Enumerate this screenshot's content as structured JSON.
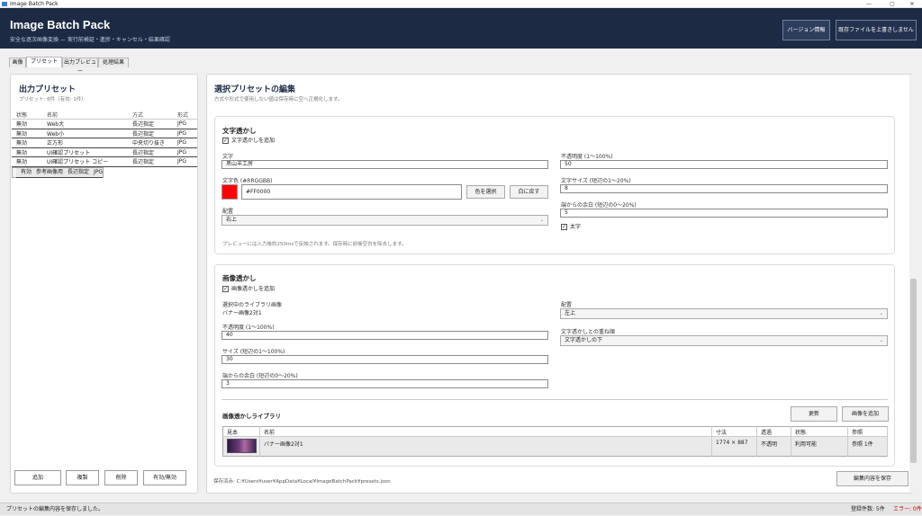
{
  "window": {
    "title": "Image Batch Pack",
    "minimize": "—",
    "maximize": "▢"
  },
  "header": {
    "title": "Image Batch Pack",
    "subtitle": "安全な逐次画像変換 — 実行前検証・進捗・キャンセル・結果確認",
    "version_button": "バージョン情報",
    "overwrite_button": "既存ファイルを上書きしません"
  },
  "tabs": [
    "画像",
    "プリセット",
    "出力プレビュー",
    "処理結果"
  ],
  "active_tab": "プリセット",
  "left": {
    "title": "出力プリセット",
    "subtitle": "プリセット: 6件（有効: 1件）",
    "columns": [
      "状態",
      "名前",
      "方式",
      "形式"
    ],
    "rows": [
      [
        "無効",
        "Web大",
        "長辺指定",
        "JPG"
      ],
      [
        "無効",
        "Web小",
        "長辺指定",
        "JPG"
      ],
      [
        "無効",
        "正方形",
        "中央切り抜き",
        "JPG"
      ],
      [
        "無効",
        "UI確認プリセット",
        "長辺指定",
        "JPG"
      ],
      [
        "無効",
        "UI確認プリセット コピー",
        "長辺指定",
        "JPG"
      ],
      [
        "有効",
        "参考画像用",
        "長辺指定",
        "JPG"
      ]
    ],
    "buttons": {
      "add": "追加",
      "duplicate": "複製",
      "delete": "削除",
      "toggle": "有効/無効"
    }
  },
  "right": {
    "title": "選択プリセットの編集",
    "subtitle": "方式や形式で使用しない値は保存時に空へ正規化します。",
    "text_wm": {
      "title": "文字透かし",
      "enable": "文字透かしを追加",
      "text_label": "文字",
      "text_value": "黒山羊工房",
      "color_label": "文字色 (#RRGGBB)",
      "color_value": "#FF0000",
      "color_hex": "#ff0000",
      "pick_color": "色を選択",
      "reset_white": "白に戻す",
      "position_label": "配置",
      "position_value": "右上",
      "note": "プレビューには入力後約250msで反映されます。保存時に前後空白を除去します。",
      "opacity_label": "不透明度 (1〜100%)",
      "opacity_value": "50",
      "size_label": "文字サイズ (短辺の1〜20%)",
      "size_value": "8",
      "margin_label": "端からの余白 (短辺の0〜20%)",
      "margin_value": "5",
      "bold": "太字"
    },
    "image_wm": {
      "title": "画像透かし",
      "enable": "画像透かしを追加",
      "lib_label": "選択中のライブラリ画像",
      "lib_value": "バナー画像2対1",
      "opacity_label": "不透明度 (1〜100%)",
      "opacity_value": "40",
      "size_label": "サイズ (短辺の1〜100%)",
      "size_value": "30",
      "margin_label": "端からの余白 (短辺の0〜20%)",
      "margin_value": "3",
      "position_label": "配置",
      "position_value": "左上",
      "order_label": "文字透かしとの重ね順",
      "order_value": "文字透かしの下"
    },
    "library": {
      "title": "画像透かしライブラリ",
      "refresh": "更新",
      "add_image": "画像を追加",
      "columns": [
        "見本",
        "名前",
        "寸法",
        "透過",
        "状態",
        "参照"
      ],
      "rows": [
        {
          "name": "バナー画像2対1",
          "size": "1774 × 887",
          "alpha": "不透明",
          "status": "利用可能",
          "refs": "参照 1件"
        }
      ]
    },
    "saved_path": "保存済み: C:¥Users¥user¥AppData¥Local¥ImageBatchPack¥presets.json",
    "save_button": "編集内容を保存"
  },
  "status": {
    "message": "プリセットの編集内容を保存しました。",
    "count": "登録件数: 5件",
    "errors": "エラー: 0件"
  }
}
